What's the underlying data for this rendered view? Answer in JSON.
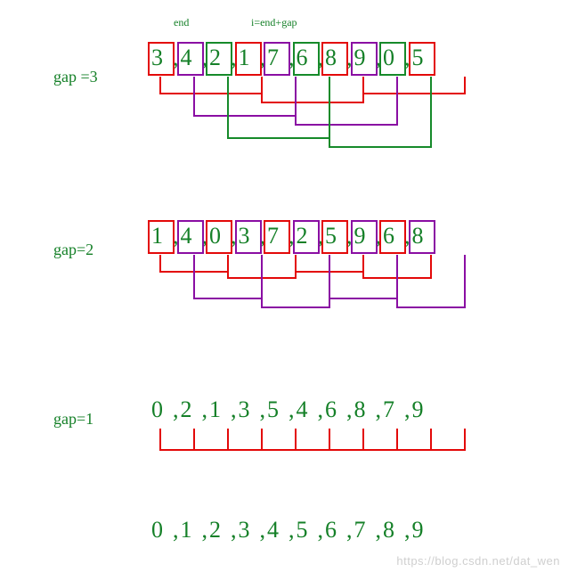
{
  "labels": {
    "gap3": "gap =3",
    "gap2": "gap=2",
    "gap1": "gap=1",
    "end": "end",
    "iend": "i=end+gap"
  },
  "rows": {
    "r1": [
      "3",
      "4",
      "2",
      "1",
      "7",
      "6",
      "8",
      "9",
      "0",
      "5"
    ],
    "r2": [
      "1",
      "4",
      "0",
      "3",
      "7",
      "2",
      "5",
      "9",
      "6",
      "8"
    ],
    "r3": [
      "0",
      "2",
      "1",
      "3",
      "5",
      "4",
      "6",
      "8",
      "7",
      "9"
    ],
    "r4": [
      "0",
      "1",
      "2",
      "3",
      "4",
      "5",
      "6",
      "7",
      "8",
      "9"
    ]
  },
  "box_colors": {
    "r1": [
      "red",
      "purple",
      "green",
      "red",
      "purple",
      "green",
      "red",
      "purple",
      "green",
      "red"
    ],
    "r2": [
      "red",
      "purple",
      "red",
      "purple",
      "red",
      "purple",
      "red",
      "purple",
      "red",
      "purple"
    ]
  },
  "chart_data": {
    "type": "diagram",
    "title": "Shell sort grouping illustration",
    "passes": [
      {
        "gap": 3,
        "input": [
          3,
          4,
          2,
          1,
          7,
          6,
          8,
          9,
          0,
          5
        ],
        "groups_by_index": [
          [
            0,
            3,
            6,
            9
          ],
          [
            1,
            4,
            7
          ],
          [
            2,
            5,
            8
          ]
        ],
        "group_colors": [
          "red",
          "purple",
          "green"
        ],
        "annotations": {
          "end_index": 0,
          "i_formula": "i=end+gap"
        }
      },
      {
        "gap": 2,
        "input": [
          1,
          4,
          0,
          3,
          7,
          2,
          5,
          9,
          6,
          8
        ],
        "groups_by_index": [
          [
            0,
            2,
            4,
            6,
            8
          ],
          [
            1,
            3,
            5,
            7,
            9
          ]
        ],
        "group_colors": [
          "red",
          "purple"
        ]
      },
      {
        "gap": 1,
        "input": [
          0,
          2,
          1,
          3,
          5,
          4,
          6,
          8,
          7,
          9
        ],
        "groups_by_index": [
          [
            0,
            1,
            2,
            3,
            4,
            5,
            6,
            7,
            8,
            9
          ]
        ],
        "group_colors": [
          "red"
        ]
      }
    ],
    "result": [
      0,
      1,
      2,
      3,
      4,
      5,
      6,
      7,
      8,
      9
    ]
  },
  "watermark": "https://blog.csdn.net/dat_wen"
}
